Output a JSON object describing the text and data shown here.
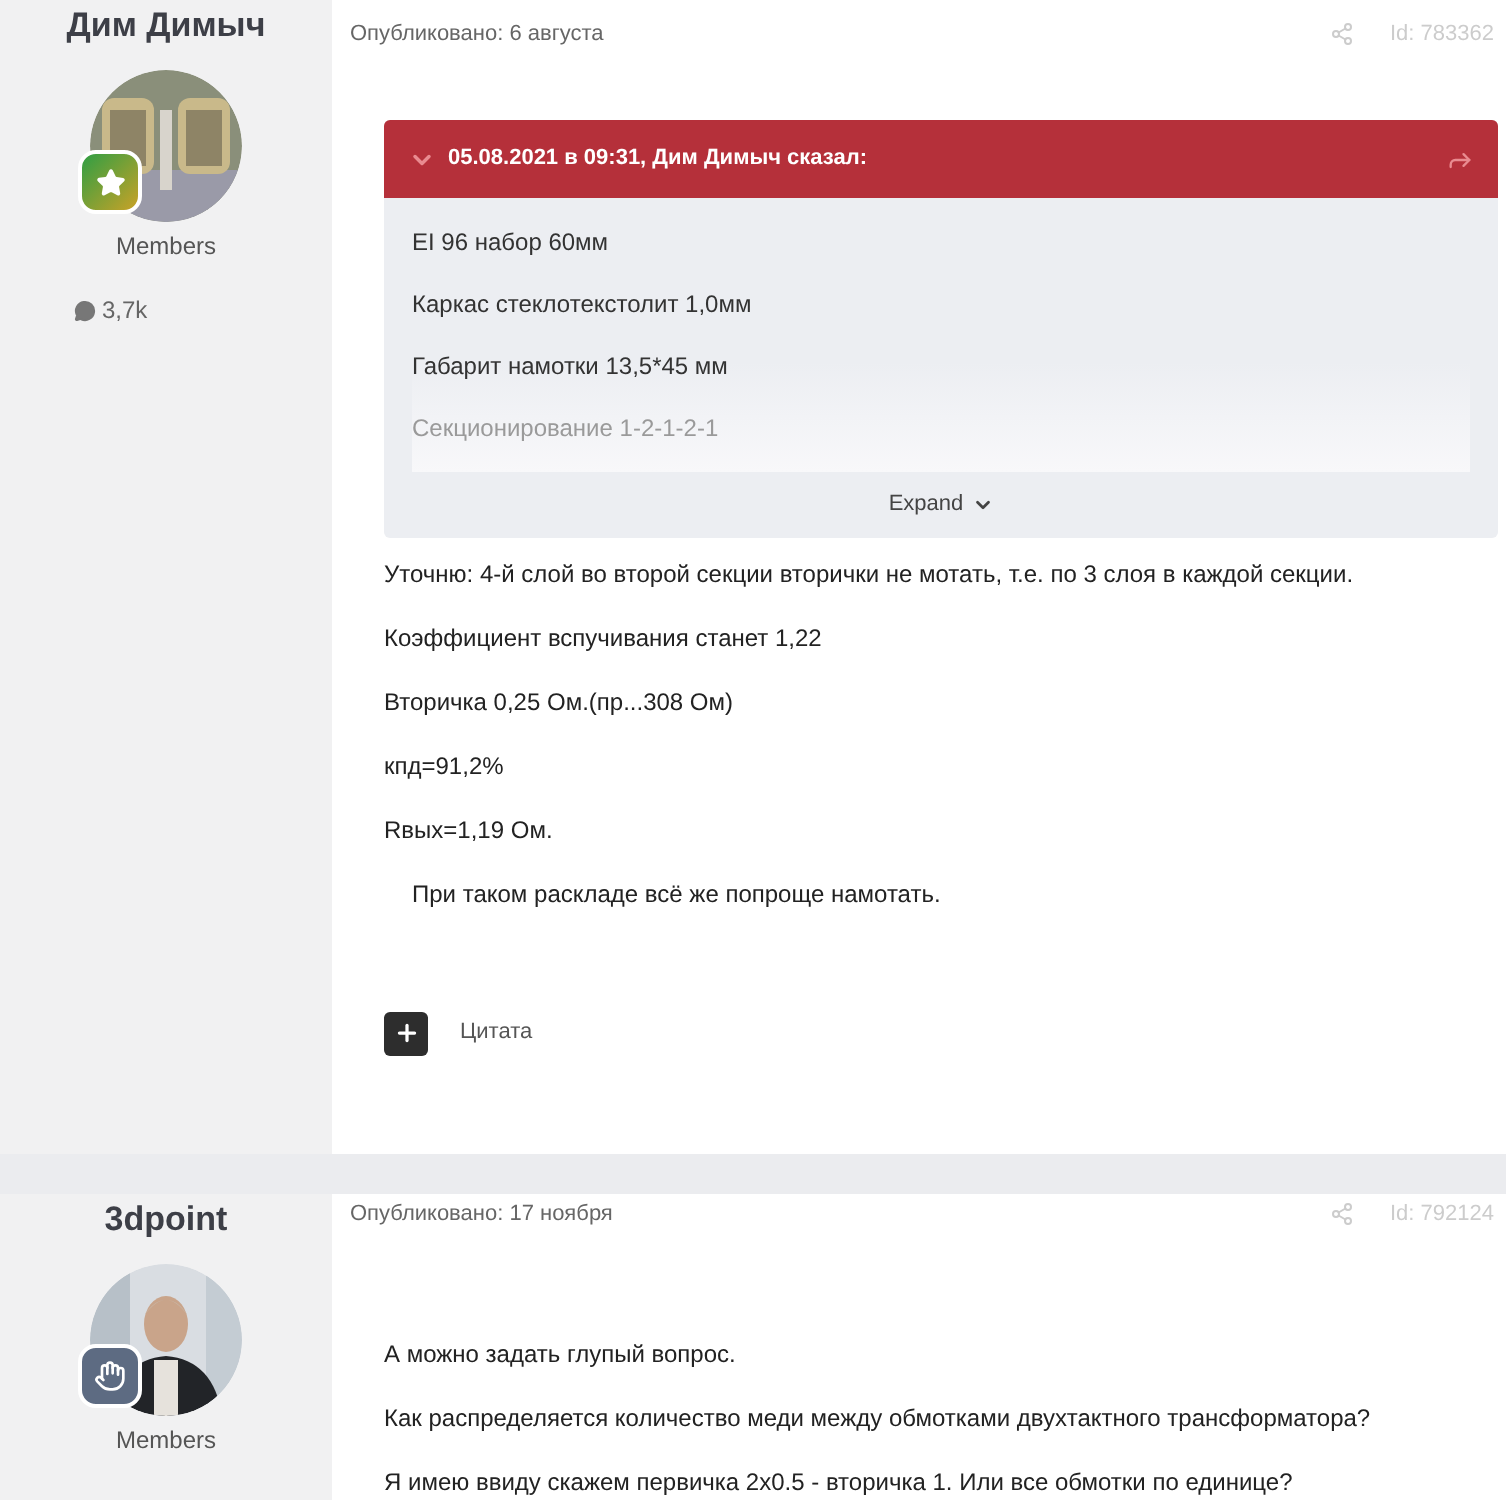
{
  "posts": [
    {
      "author": "Дим Димыч",
      "badge": {
        "kind": "star"
      },
      "role": "Members",
      "post_count": "3,7k",
      "date": "Опубликовано: 6 августа",
      "id": "Id: 783362",
      "quote": {
        "header": "05.08.2021 в 09:31, Дим Димыч сказал:",
        "lines": [
          "EI 96  набор 60мм",
          "Каркас стеклотекстолит 1,0мм",
          "Габарит намотки 13,5*45 мм",
          "Секционирование 1-2-1-2-1"
        ],
        "expand": "Expand"
      },
      "paragraphs": [
        {
          "text": "Уточню:  4-й слой во второй секции вторички не мотать, т.е. по 3 слоя в каждой секции.",
          "indent": false
        },
        {
          "text": "Коэффициент вспучивания станет 1,22",
          "indent": false
        },
        {
          "text": "Вторичка 0,25 Ом.(пр...308 Ом)",
          "indent": false
        },
        {
          "text": "кпд=91,2%",
          "indent": false
        },
        {
          "text": "Rвых=1,19 Ом.",
          "indent": false
        },
        {
          "text": "При таком раскладе всё же попроще намотать.",
          "indent": true
        }
      ],
      "quote_action": "Цитата"
    },
    {
      "author": "3dpoint",
      "badge": {
        "kind": "hand"
      },
      "role": "Members",
      "date": "Опубликовано: 17 ноября",
      "id": "Id: 792124",
      "paragraphs": [
        {
          "text": "А можно задать глупый вопрос.",
          "indent": false
        },
        {
          "text": "Как распределяется количество меди между обмотками двухтактного трансформатора?",
          "indent": false
        },
        {
          "text": "Я имею ввиду скажем первичка 2х0.5 - вторичка 1. Или все обмотки по единице?",
          "indent": false
        }
      ]
    }
  ]
}
